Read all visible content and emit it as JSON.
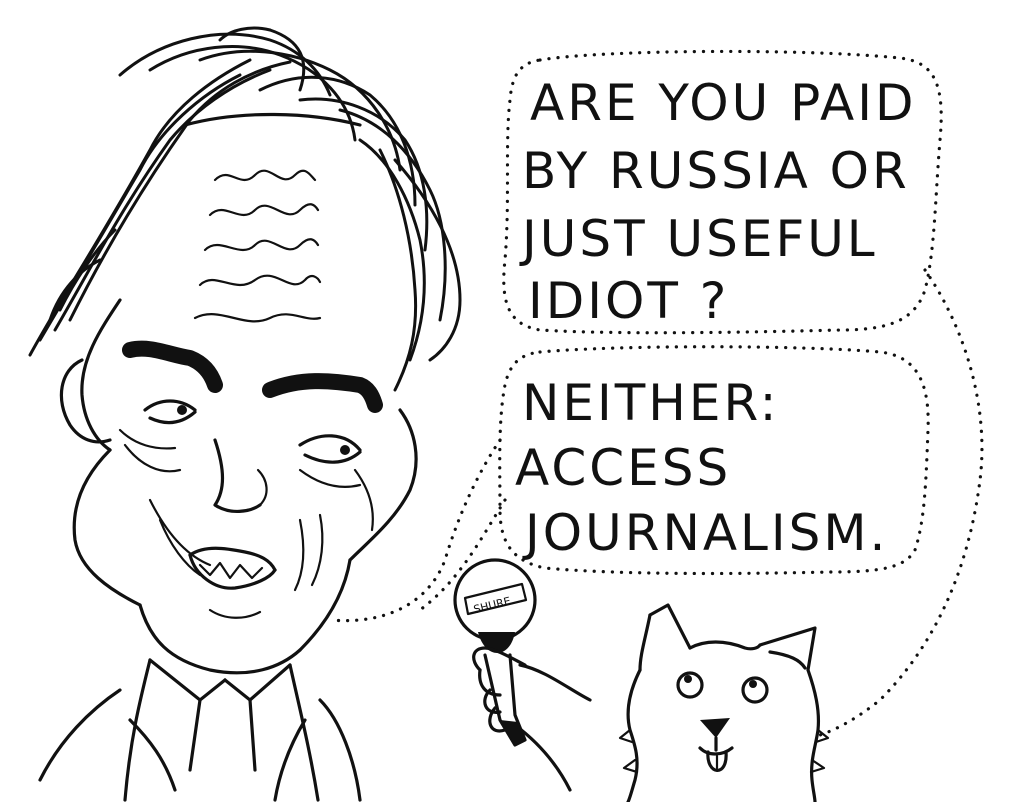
{
  "speech_bubble_question": {
    "lines": [
      "ARE YOU PAID",
      "BY RUSSIA OR",
      "JUST USEFUL",
      "IDIOT ?"
    ]
  },
  "speech_bubble_answer": {
    "lines": [
      "NEITHER:",
      "ACCESS",
      "JOURNALISM."
    ]
  },
  "microphone": {
    "brand_label": "SHURE"
  },
  "colors": {
    "ink": "#111111",
    "paper": "#ffffff"
  }
}
